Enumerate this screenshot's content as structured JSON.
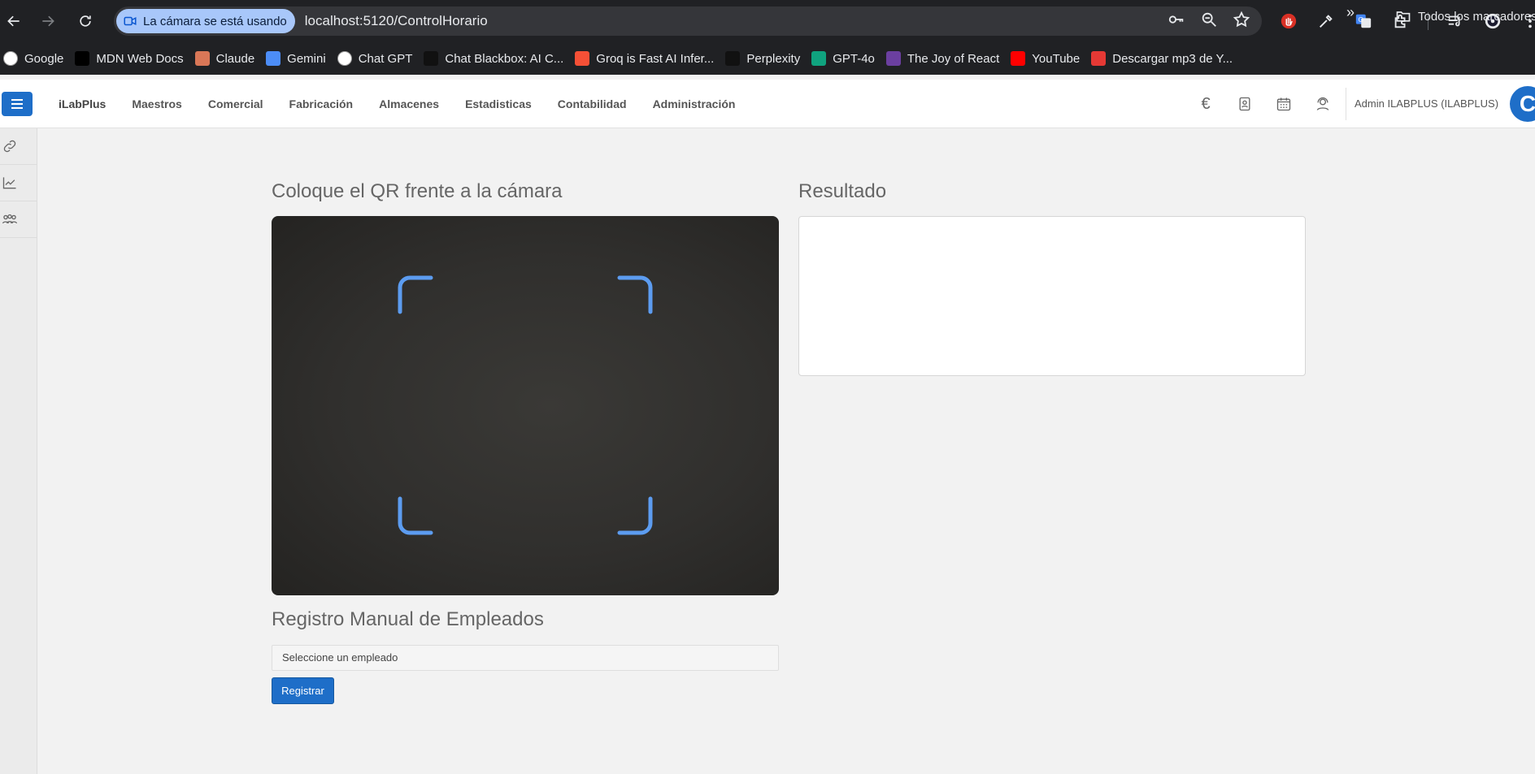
{
  "browser": {
    "camera_chip": "La cámara se está usando",
    "url": "localhost:5120/ControlHorario",
    "bookmarks": [
      {
        "label": "Google",
        "icon": "google-icon",
        "color": "#ffffff"
      },
      {
        "label": "MDN Web Docs",
        "icon": "mdn-icon",
        "color": "#000000"
      },
      {
        "label": "Claude",
        "icon": "claude-icon",
        "color": "#d97757"
      },
      {
        "label": "Gemini",
        "icon": "gemini-icon",
        "color": "#4c8df6"
      },
      {
        "label": "Chat  GPT",
        "icon": "chatgpt-icon",
        "color": "#ffffff"
      },
      {
        "label": "Chat Blackbox: AI C...",
        "icon": "blackbox-icon",
        "color": "#111111"
      },
      {
        "label": "Groq is Fast AI Infer...",
        "icon": "groq-icon",
        "color": "#f55036"
      },
      {
        "label": "Perplexity",
        "icon": "perplexity-icon",
        "color": "#111111"
      },
      {
        "label": "GPT-4o",
        "icon": "gpt4o-icon",
        "color": "#10a37f"
      },
      {
        "label": "The Joy of React",
        "icon": "joy-react-icon",
        "color": "#6b3fa0"
      },
      {
        "label": "YouTube",
        "icon": "youtube-icon",
        "color": "#ff0000"
      },
      {
        "label": "Descargar mp3 de Y...",
        "icon": "download-icon",
        "color": "#e53935"
      }
    ],
    "more_bookmarks": "»",
    "all_bookmarks": "Todos los marcadores"
  },
  "app": {
    "menu": [
      "iLabPlus",
      "Maestros",
      "Comercial",
      "Fabricación",
      "Almacenes",
      "Estadisticas",
      "Contabilidad",
      "Administración"
    ],
    "currency_symbol": "€",
    "user": "Admin ILABPLUS (ILABPLUS)",
    "avatar_letter": "C",
    "accent_color": "#1e6ec8"
  },
  "page": {
    "camera_title": "Coloque el QR frente a la cámara",
    "result_title": "Resultado",
    "manual_title": "Registro Manual de Empleados",
    "employee_select_placeholder": "Seleccione un empleado",
    "register_button": "Registrar"
  }
}
